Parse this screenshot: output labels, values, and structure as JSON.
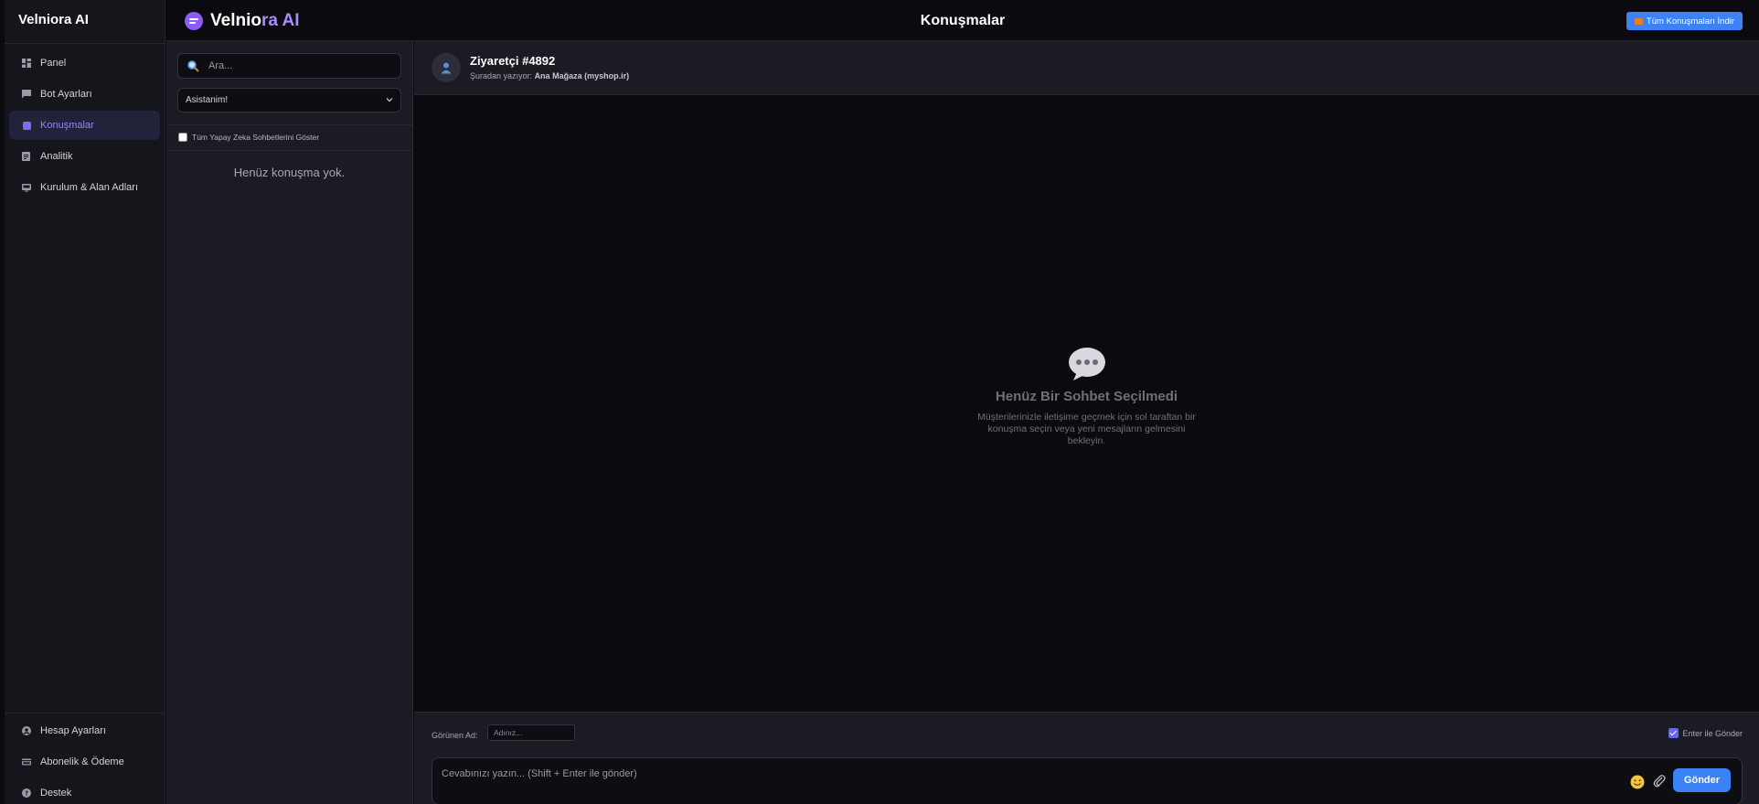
{
  "sidebar": {
    "brand": "Velniora AI",
    "nav_top": [
      {
        "label": "Panel",
        "icon": "dashboard-icon"
      },
      {
        "label": "Bot Ayarları",
        "icon": "chat-icon"
      },
      {
        "label": "Konuşmalar",
        "icon": "conversations-icon",
        "active": true
      },
      {
        "label": "Analitik",
        "icon": "analytics-icon"
      },
      {
        "label": "Kurulum & Alan Adları",
        "icon": "monitor-icon"
      }
    ],
    "nav_bottom": [
      {
        "label": "Hesap Ayarları",
        "icon": "account-icon"
      },
      {
        "label": "Abonelik & Ödeme",
        "icon": "card-icon"
      },
      {
        "label": "Destek",
        "icon": "help-icon"
      }
    ]
  },
  "header": {
    "logo_text": "Velnio",
    "logo_accent": "ra AI",
    "title": "Konuşmalar",
    "download_label": "Tüm Konuşmaları İndir"
  },
  "list": {
    "search_placeholder": "Ara...",
    "assistant_selected": "Asistanim!",
    "show_all_label": "Tüm Yapay Zeka Sohbetlerini Göster",
    "empty_text": "Henüz konuşma yok."
  },
  "chat": {
    "visitor_name": "Ziyaretçi #4892",
    "source_prefix": "Şuradan yazıyor:",
    "source_value": "Ana Mağaza (myshop.ir)",
    "empty_title": "Henüz Bir Sohbet Seçilmedi",
    "empty_desc": "Müşterilerinizle iletişime geçmek için sol taraftan bir konuşma seçin veya yeni mesajların gelmesini bekleyin."
  },
  "composer": {
    "name_label": "Görünen Ad:",
    "name_placeholder": "Adınız...",
    "enter_send_label": "Enter ile Gönder",
    "enter_send_checked": true,
    "reply_placeholder": "Cevabınızı yazın... (Shift + Enter ile gönder)",
    "send_label": "Gönder"
  },
  "colors": {
    "accent": "#7b6df0",
    "primary_button": "#3b82f6",
    "background": "#0b0b0f",
    "panel": "#1b1b23"
  }
}
